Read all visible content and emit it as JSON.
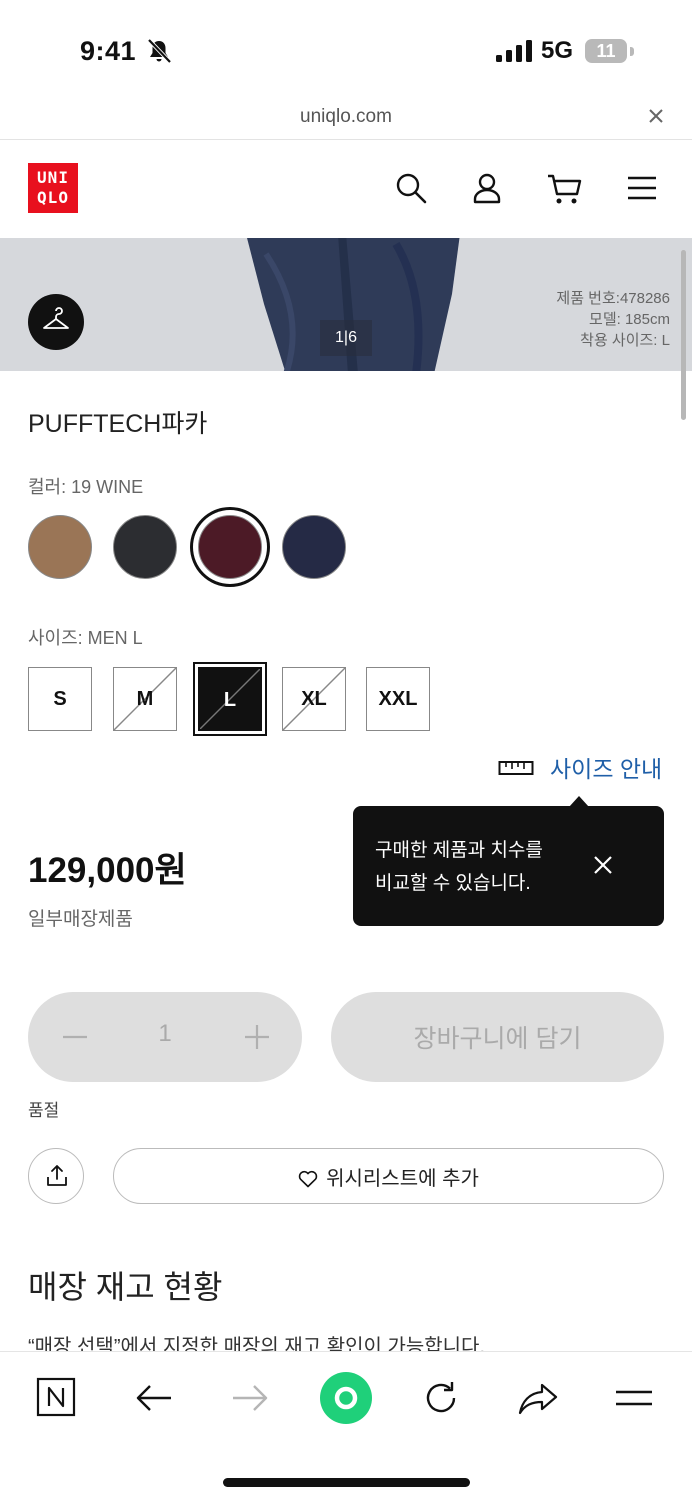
{
  "status_bar": {
    "time": "9:41",
    "network": "5G",
    "battery": "11"
  },
  "url_bar": {
    "url": "uniqlo.com"
  },
  "header": {
    "logo_line1": "UNI",
    "logo_line2": "QLO",
    "brand_color": "#e8101e"
  },
  "gallery": {
    "counter": "1|6",
    "product_number": "제품 번호:478286",
    "model_height": "모델: 185cm",
    "model_size": "착용 사이즈: L"
  },
  "product": {
    "name": "PUFFTECH파카",
    "color_label": "컬러: 19 WINE",
    "colors": [
      {
        "name": "brown",
        "hex": "#9a7556"
      },
      {
        "name": "black",
        "hex": "#2c2d31"
      },
      {
        "name": "wine",
        "hex": "#4c1a26",
        "selected": true
      },
      {
        "name": "navy",
        "hex": "#252a45"
      }
    ],
    "size_label": "사이즈: MEN L",
    "sizes": [
      {
        "label": "S",
        "available": true
      },
      {
        "label": "M",
        "available": false
      },
      {
        "label": "L",
        "available": false,
        "selected": true
      },
      {
        "label": "XL",
        "available": false
      },
      {
        "label": "XXL",
        "available": true
      }
    ],
    "size_guide": "사이즈 안내",
    "price": "129,000원",
    "price_note": "일부매장제품"
  },
  "tooltip": {
    "line1": "구매한 제품과 치수를",
    "line2": "비교할 수 있습니다."
  },
  "purchase": {
    "quantity": "1",
    "add_to_cart": "장바구니에 담기",
    "stock_status": "품절",
    "wishlist": "위시리스트에 추가"
  },
  "store_stock": {
    "title": "매장 재고 현황",
    "description": "“매장 선택”에서 지정한 매장의 재고 확인이 가능합니다."
  },
  "browser_nav": {
    "icons": [
      "n-home-icon",
      "back-arrow-icon",
      "forward-arrow-icon",
      "green-dot-icon",
      "reload-icon",
      "share-arrow-icon",
      "menu-icon"
    ],
    "accent": "#1fd07a"
  }
}
